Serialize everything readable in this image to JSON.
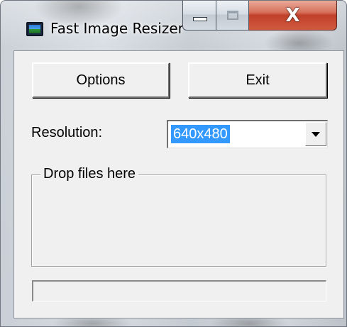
{
  "window": {
    "title": "Fast Image Resizer",
    "icon": "landscape-picture-icon",
    "caption_buttons": {
      "minimize_icon": "minimize-icon",
      "maximize_icon": "maximize-icon",
      "close_glyph": "X"
    }
  },
  "toolbar": {
    "options_label": "Options",
    "exit_label": "Exit"
  },
  "resolution": {
    "label": "Resolution:",
    "selected": "640x480"
  },
  "drop_area": {
    "label": "Drop files here"
  },
  "progress": {
    "value": 0
  },
  "colors": {
    "selection_highlight": "#3399ff",
    "close_button": "#c0402a",
    "client_background": "#f0f0f0"
  }
}
